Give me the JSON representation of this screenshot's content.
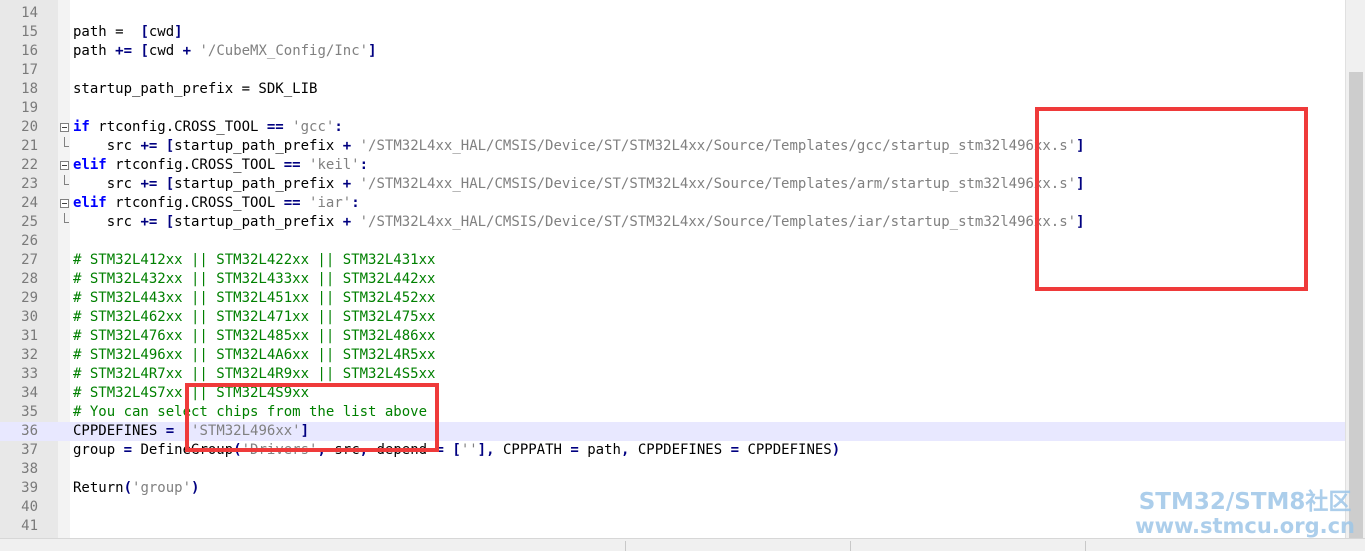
{
  "editor": {
    "lines": [
      {
        "num": "14",
        "tokens": []
      },
      {
        "num": "15",
        "tokens": [
          {
            "t": "path = ",
            "c": "plain"
          },
          {
            "t": " [",
            "c": "op"
          },
          {
            "t": "cwd",
            "c": "plain"
          },
          {
            "t": "]",
            "c": "op"
          }
        ]
      },
      {
        "num": "16",
        "tokens": [
          {
            "t": "path ",
            "c": "plain"
          },
          {
            "t": "+=",
            "c": "op"
          },
          {
            "t": " ",
            "c": "plain"
          },
          {
            "t": "[",
            "c": "op"
          },
          {
            "t": "cwd ",
            "c": "plain"
          },
          {
            "t": "+",
            "c": "op"
          },
          {
            "t": " ",
            "c": "plain"
          },
          {
            "t": "'/CubeMX_Config/Inc'",
            "c": "str"
          },
          {
            "t": "]",
            "c": "op"
          }
        ]
      },
      {
        "num": "17",
        "tokens": []
      },
      {
        "num": "18",
        "tokens": [
          {
            "t": "startup_path_prefix = SDK_LIB",
            "c": "plain"
          }
        ]
      },
      {
        "num": "19",
        "tokens": []
      },
      {
        "num": "20",
        "fold": "start",
        "tokens": [
          {
            "t": "if",
            "c": "kw"
          },
          {
            "t": " rtconfig.CROSS_TOOL ",
            "c": "plain"
          },
          {
            "t": "==",
            "c": "op"
          },
          {
            "t": " ",
            "c": "plain"
          },
          {
            "t": "'gcc'",
            "c": "str"
          },
          {
            "t": ":",
            "c": "op"
          }
        ]
      },
      {
        "num": "21",
        "fold": "end",
        "tokens": [
          {
            "t": "    src ",
            "c": "plain"
          },
          {
            "t": "+=",
            "c": "op"
          },
          {
            "t": " ",
            "c": "plain"
          },
          {
            "t": "[",
            "c": "op"
          },
          {
            "t": "startup_path_prefix ",
            "c": "plain"
          },
          {
            "t": "+",
            "c": "op"
          },
          {
            "t": " ",
            "c": "plain"
          },
          {
            "t": "'/STM32L4xx_HAL/CMSIS/Device/ST/STM32L4xx/Source/Templates/gcc/startup_stm32l496xx.s'",
            "c": "str"
          },
          {
            "t": "]",
            "c": "op"
          }
        ]
      },
      {
        "num": "22",
        "fold": "start",
        "tokens": [
          {
            "t": "elif",
            "c": "kw"
          },
          {
            "t": " rtconfig.CROSS_TOOL ",
            "c": "plain"
          },
          {
            "t": "==",
            "c": "op"
          },
          {
            "t": " ",
            "c": "plain"
          },
          {
            "t": "'keil'",
            "c": "str"
          },
          {
            "t": ":",
            "c": "op"
          }
        ]
      },
      {
        "num": "23",
        "fold": "end",
        "tokens": [
          {
            "t": "    src ",
            "c": "plain"
          },
          {
            "t": "+=",
            "c": "op"
          },
          {
            "t": " ",
            "c": "plain"
          },
          {
            "t": "[",
            "c": "op"
          },
          {
            "t": "startup_path_prefix ",
            "c": "plain"
          },
          {
            "t": "+",
            "c": "op"
          },
          {
            "t": " ",
            "c": "plain"
          },
          {
            "t": "'/STM32L4xx_HAL/CMSIS/Device/ST/STM32L4xx/Source/Templates/arm/startup_stm32l496xx.s'",
            "c": "str"
          },
          {
            "t": "]",
            "c": "op"
          }
        ]
      },
      {
        "num": "24",
        "fold": "start",
        "tokens": [
          {
            "t": "elif",
            "c": "kw"
          },
          {
            "t": " rtconfig.CROSS_TOOL ",
            "c": "plain"
          },
          {
            "t": "==",
            "c": "op"
          },
          {
            "t": " ",
            "c": "plain"
          },
          {
            "t": "'iar'",
            "c": "str"
          },
          {
            "t": ":",
            "c": "op"
          }
        ]
      },
      {
        "num": "25",
        "fold": "end",
        "tokens": [
          {
            "t": "    src ",
            "c": "plain"
          },
          {
            "t": "+=",
            "c": "op"
          },
          {
            "t": " ",
            "c": "plain"
          },
          {
            "t": "[",
            "c": "op"
          },
          {
            "t": "startup_path_prefix ",
            "c": "plain"
          },
          {
            "t": "+",
            "c": "op"
          },
          {
            "t": " ",
            "c": "plain"
          },
          {
            "t": "'/STM32L4xx_HAL/CMSIS/Device/ST/STM32L4xx/Source/Templates/iar/startup_stm32l496xx.s'",
            "c": "str"
          },
          {
            "t": "]",
            "c": "op"
          }
        ]
      },
      {
        "num": "26",
        "tokens": []
      },
      {
        "num": "27",
        "tokens": [
          {
            "t": "# STM32L412xx || STM32L422xx || STM32L431xx",
            "c": "cmt"
          }
        ]
      },
      {
        "num": "28",
        "tokens": [
          {
            "t": "# STM32L432xx || STM32L433xx || STM32L442xx",
            "c": "cmt"
          }
        ]
      },
      {
        "num": "29",
        "tokens": [
          {
            "t": "# STM32L443xx || STM32L451xx || STM32L452xx",
            "c": "cmt"
          }
        ]
      },
      {
        "num": "30",
        "tokens": [
          {
            "t": "# STM32L462xx || STM32L471xx || STM32L475xx",
            "c": "cmt"
          }
        ]
      },
      {
        "num": "31",
        "tokens": [
          {
            "t": "# STM32L476xx || STM32L485xx || STM32L486xx",
            "c": "cmt"
          }
        ]
      },
      {
        "num": "32",
        "tokens": [
          {
            "t": "# STM32L496xx || STM32L4A6xx || STM32L4R5xx",
            "c": "cmt"
          }
        ]
      },
      {
        "num": "33",
        "tokens": [
          {
            "t": "# STM32L4R7xx || STM32L4R9xx || STM32L4S5xx",
            "c": "cmt"
          }
        ]
      },
      {
        "num": "34",
        "tokens": [
          {
            "t": "# STM32L4S7xx || STM32L4S9xx",
            "c": "cmt"
          }
        ]
      },
      {
        "num": "35",
        "tokens": [
          {
            "t": "# You can select chips from the list above",
            "c": "cmt"
          }
        ]
      },
      {
        "num": "36",
        "current": true,
        "tokens": [
          {
            "t": "CPPDEFINES ",
            "c": "plain"
          },
          {
            "t": "=",
            "c": "op"
          },
          {
            "t": " ",
            "c": "plain"
          },
          {
            "t": "[",
            "c": "op"
          },
          {
            "t": "'STM32L496xx'",
            "c": "str"
          },
          {
            "t": "]",
            "c": "op"
          }
        ]
      },
      {
        "num": "37",
        "tokens": [
          {
            "t": "group ",
            "c": "plain"
          },
          {
            "t": "=",
            "c": "op"
          },
          {
            "t": " DefineGroup",
            "c": "plain"
          },
          {
            "t": "(",
            "c": "op"
          },
          {
            "t": "'Drivers'",
            "c": "str"
          },
          {
            "t": ",",
            "c": "op"
          },
          {
            "t": " src",
            "c": "plain"
          },
          {
            "t": ",",
            "c": "op"
          },
          {
            "t": " depend ",
            "c": "plain"
          },
          {
            "t": "=",
            "c": "op"
          },
          {
            "t": " ",
            "c": "plain"
          },
          {
            "t": "[",
            "c": "op"
          },
          {
            "t": "''",
            "c": "str"
          },
          {
            "t": "],",
            "c": "op"
          },
          {
            "t": " CPPPATH ",
            "c": "plain"
          },
          {
            "t": "=",
            "c": "op"
          },
          {
            "t": " path",
            "c": "plain"
          },
          {
            "t": ",",
            "c": "op"
          },
          {
            "t": " CPPDEFINES ",
            "c": "plain"
          },
          {
            "t": "=",
            "c": "op"
          },
          {
            "t": " CPPDEFINES",
            "c": "plain"
          },
          {
            "t": ")",
            "c": "op"
          }
        ]
      },
      {
        "num": "38",
        "tokens": []
      },
      {
        "num": "39",
        "tokens": [
          {
            "t": "Return",
            "c": "plain"
          },
          {
            "t": "(",
            "c": "op"
          },
          {
            "t": "'group'",
            "c": "str"
          },
          {
            "t": ")",
            "c": "op"
          }
        ]
      },
      {
        "num": "40",
        "tokens": []
      },
      {
        "num": "41",
        "tokens": []
      }
    ]
  },
  "watermark": {
    "line1": "STM32/STM8社区",
    "line2": "www.stmcu.org.cn"
  },
  "colors": {
    "highlight": "#ef3a3a",
    "current_line": "#e8e8ff",
    "keyword": "#0000ff",
    "string": "#808080",
    "comment": "#008000",
    "operator": "#000080"
  }
}
